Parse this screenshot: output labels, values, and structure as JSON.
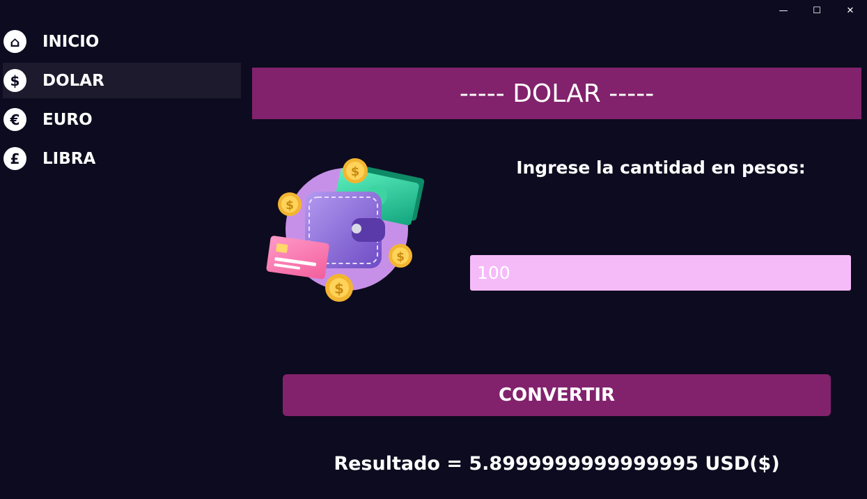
{
  "window": {
    "minimize_glyph": "—",
    "maximize_glyph": "☐",
    "close_glyph": "✕"
  },
  "sidebar": {
    "items": [
      {
        "label": "INICIO",
        "icon": "home-icon",
        "glyph": "⌂"
      },
      {
        "label": "DOLAR",
        "icon": "dollar-icon",
        "glyph": "$",
        "active": true
      },
      {
        "label": "EURO",
        "icon": "euro-icon",
        "glyph": "€"
      },
      {
        "label": "LIBRA",
        "icon": "pound-icon",
        "glyph": "£"
      }
    ]
  },
  "main": {
    "header": "----- DOLAR -----",
    "prompt": "Ingrese la cantidad en pesos:",
    "input_value": "100",
    "convert_label": "CONVERTIR",
    "result": "Resultado = 5.8999999999999995 USD($)"
  },
  "colors": {
    "background": "#0d0b1f",
    "accent": "#82226c",
    "input_bg": "#f5bbf9",
    "active_item": "#1c1a2c"
  }
}
